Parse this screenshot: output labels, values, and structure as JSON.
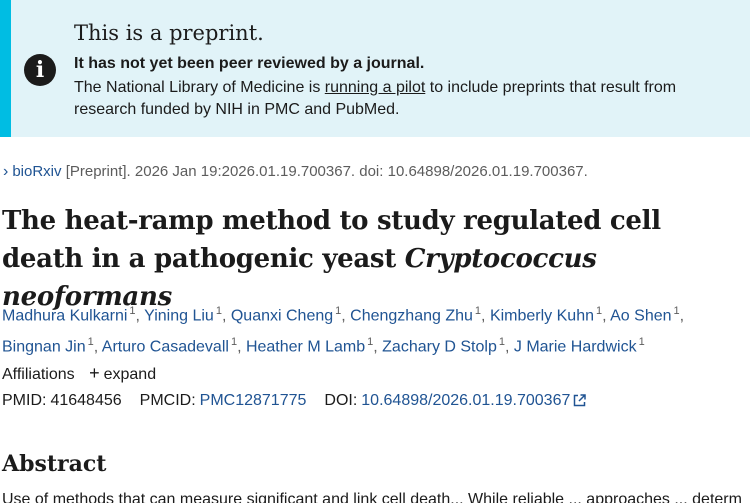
{
  "banner": {
    "title": "This is a preprint.",
    "subtitle": "It has not yet been peer reviewed by a journal.",
    "text_before": "The National Library of Medicine is ",
    "link": "running a pilot",
    "text_after": " to include preprints that result from research funded by NIH in PMC and PubMed.",
    "icon": "info-icon"
  },
  "citation": {
    "journal": "bioRxiv",
    "rest": "[Preprint]. 2026 Jan 19:2026.01.19.700367. doi: 10.64898/2026.01.19.700367."
  },
  "article": {
    "title_plain": "The heat-ramp method to study regulated cell death in a pathogenic yeast ",
    "title_italic": "Cryptococcus neoformans"
  },
  "authors": [
    {
      "name": "Madhura Kulkarni",
      "aff": "1"
    },
    {
      "name": "Yining Liu",
      "aff": "1"
    },
    {
      "name": "Quanxi Cheng",
      "aff": "1"
    },
    {
      "name": "Chengzhang Zhu",
      "aff": "1"
    },
    {
      "name": "Kimberly Kuhn",
      "aff": "1"
    },
    {
      "name": "Ao Shen",
      "aff": "1"
    },
    {
      "name": "Bingnan Jin",
      "aff": "1"
    },
    {
      "name": "Arturo Casadevall",
      "aff": "1"
    },
    {
      "name": "Heather M Lamb",
      "aff": "1"
    },
    {
      "name": "Zachary D Stolp",
      "aff": "1"
    },
    {
      "name": "J Marie Hardwick",
      "aff": "1"
    }
  ],
  "affiliations": {
    "label": "Affiliations",
    "expand": "expand"
  },
  "ids": {
    "pmid_label": "PMID:",
    "pmid": "41648456",
    "pmcid_label": "PMCID:",
    "pmcid": "PMC12871775",
    "doi_label": "DOI:",
    "doi": "10.64898/2026.01.19.700367"
  },
  "abstract": {
    "heading": "Abstract",
    "first_line": "Use of methods that can measure significant and link cell death... While reliable ... approaches ... determ"
  },
  "colors": {
    "banner_bg": "#e1f3f8",
    "banner_bar": "#00bde3",
    "link": "#205493"
  }
}
